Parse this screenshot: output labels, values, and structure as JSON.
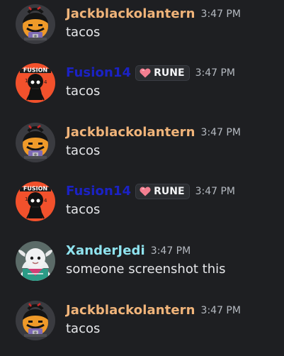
{
  "colors": {
    "background": "#1e1f22",
    "jack_name": "#f0b47a",
    "fusion_name": "#1b22c5",
    "xander_name": "#8fe3ef",
    "timestamp": "#b5bac1",
    "message_text": "#e6e7ea",
    "tag_heart": "#f47f91"
  },
  "messages": [
    {
      "username": "Jackblackolantern",
      "time": "3:47 PM",
      "text": "tacos",
      "avatar_icon": "jack-o-lantern-avatar"
    },
    {
      "username": "Fusion14",
      "tag": "RUNE",
      "tag_icon": "heart-icon",
      "time": "3:47 PM",
      "text": "tacos",
      "avatar_icon": "fusion-character-avatar",
      "avatar_text": "FUSION"
    },
    {
      "username": "Jackblackolantern",
      "time": "3:47 PM",
      "text": "tacos",
      "avatar_icon": "jack-o-lantern-avatar"
    },
    {
      "username": "Fusion14",
      "tag": "RUNE",
      "tag_icon": "heart-icon",
      "time": "3:47 PM",
      "text": "tacos",
      "avatar_icon": "fusion-character-avatar",
      "avatar_text": "FUSION"
    },
    {
      "username": "XanderJedi",
      "time": "3:47 PM",
      "text": "someone screenshot this",
      "avatar_icon": "goat-character-avatar"
    },
    {
      "username": "Jackblackolantern",
      "time": "3:47 PM",
      "text": "tacos",
      "avatar_icon": "jack-o-lantern-avatar"
    }
  ]
}
